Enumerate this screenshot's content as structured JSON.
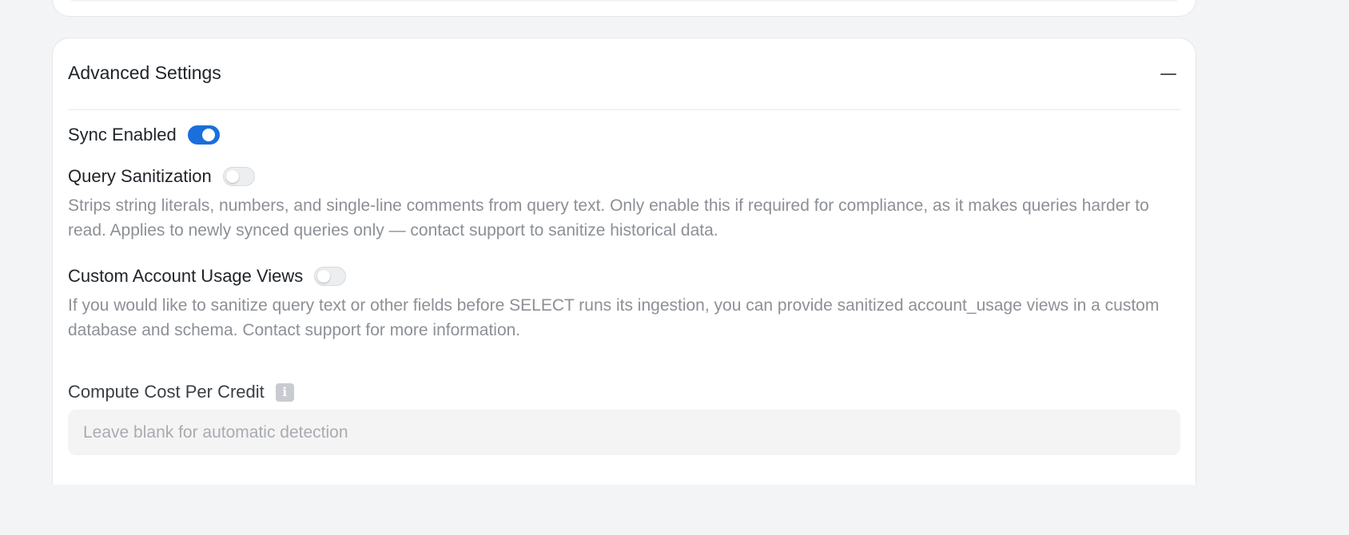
{
  "advanced_settings": {
    "title": "Advanced Settings",
    "collapse_icon": "minus-icon"
  },
  "sync_enabled": {
    "label": "Sync Enabled",
    "on": true
  },
  "query_sanitization": {
    "label": "Query Sanitization",
    "on": false,
    "description": "Strips string literals, numbers, and single-line comments from query text. Only enable this if required for compliance, as it makes queries harder to read. Applies to newly synced queries only — contact support to sanitize historical data."
  },
  "custom_account_usage_views": {
    "label": "Custom Account Usage Views",
    "on": false,
    "description": "If you would like to sanitize query text or other fields before SELECT runs its ingestion, you can provide sanitized account_usage views in a custom database and schema. Contact support for more information."
  },
  "compute_cost_per_credit": {
    "label": "Compute Cost Per Credit",
    "info_icon": "info-icon",
    "info_glyph": "i",
    "value": "",
    "placeholder": "Leave blank for automatic detection"
  },
  "colors": {
    "accent": "#1a6fdc",
    "background": "#f3f4f6",
    "card": "#ffffff",
    "muted_text": "#8c9096"
  }
}
